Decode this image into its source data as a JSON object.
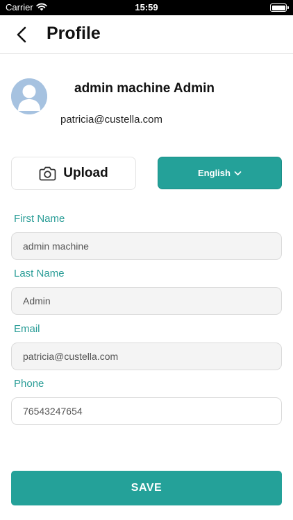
{
  "status_bar": {
    "carrier": "Carrier",
    "time": "15:59"
  },
  "header": {
    "title": "Profile"
  },
  "profile": {
    "name": "admin machine Admin",
    "email": "patricia@custella.com"
  },
  "actions": {
    "upload_label": "Upload",
    "language_label": "English"
  },
  "form": {
    "first_name": {
      "label": "First Name",
      "value": "admin machine"
    },
    "last_name": {
      "label": "Last Name",
      "value": "Admin"
    },
    "email": {
      "label": "Email",
      "value": "patricia@custella.com"
    },
    "phone": {
      "label": "Phone",
      "value": "76543247654"
    }
  },
  "save_label": "SAVE",
  "colors": {
    "accent": "#24a199",
    "label": "#2a9d97",
    "avatar": "#a6c2e0"
  },
  "icons": [
    "wifi-icon",
    "battery-icon",
    "back-arrow-icon",
    "avatar-icon",
    "camera-icon",
    "chevron-down-icon"
  ]
}
